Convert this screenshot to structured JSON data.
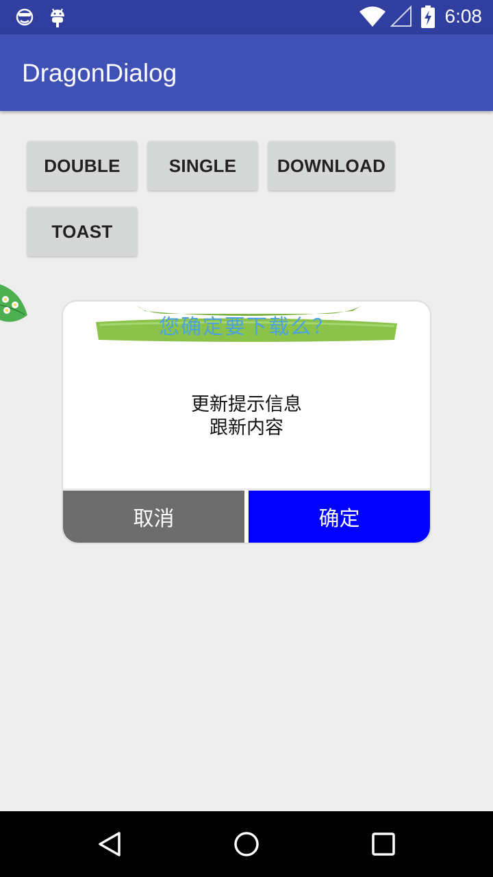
{
  "status_bar": {
    "time": "6:08",
    "left_icons": [
      "sunglasses-face-icon",
      "android-icon"
    ],
    "right_icons": [
      "wifi-icon",
      "cell-signal-icon",
      "battery-charging-icon"
    ]
  },
  "app_bar": {
    "title": "DragonDialog",
    "color": "#3f51b5"
  },
  "buttons": [
    {
      "label": "DOUBLE"
    },
    {
      "label": "SINGLE"
    },
    {
      "label": "DOWNLOAD"
    },
    {
      "label": "TOAST"
    }
  ],
  "dialog": {
    "title": "您确定要下载么？",
    "title_color": "#4aa3df",
    "banner_color": "#8bc34a",
    "message_line1": "更新提示信息",
    "message_line2": "跟新内容",
    "cancel_label": "取消",
    "cancel_color": "#6d6d6d",
    "confirm_label": "确定",
    "confirm_color": "#0000ff"
  },
  "nav_bar": {
    "icons": [
      "back-icon",
      "home-icon",
      "recents-icon"
    ]
  }
}
